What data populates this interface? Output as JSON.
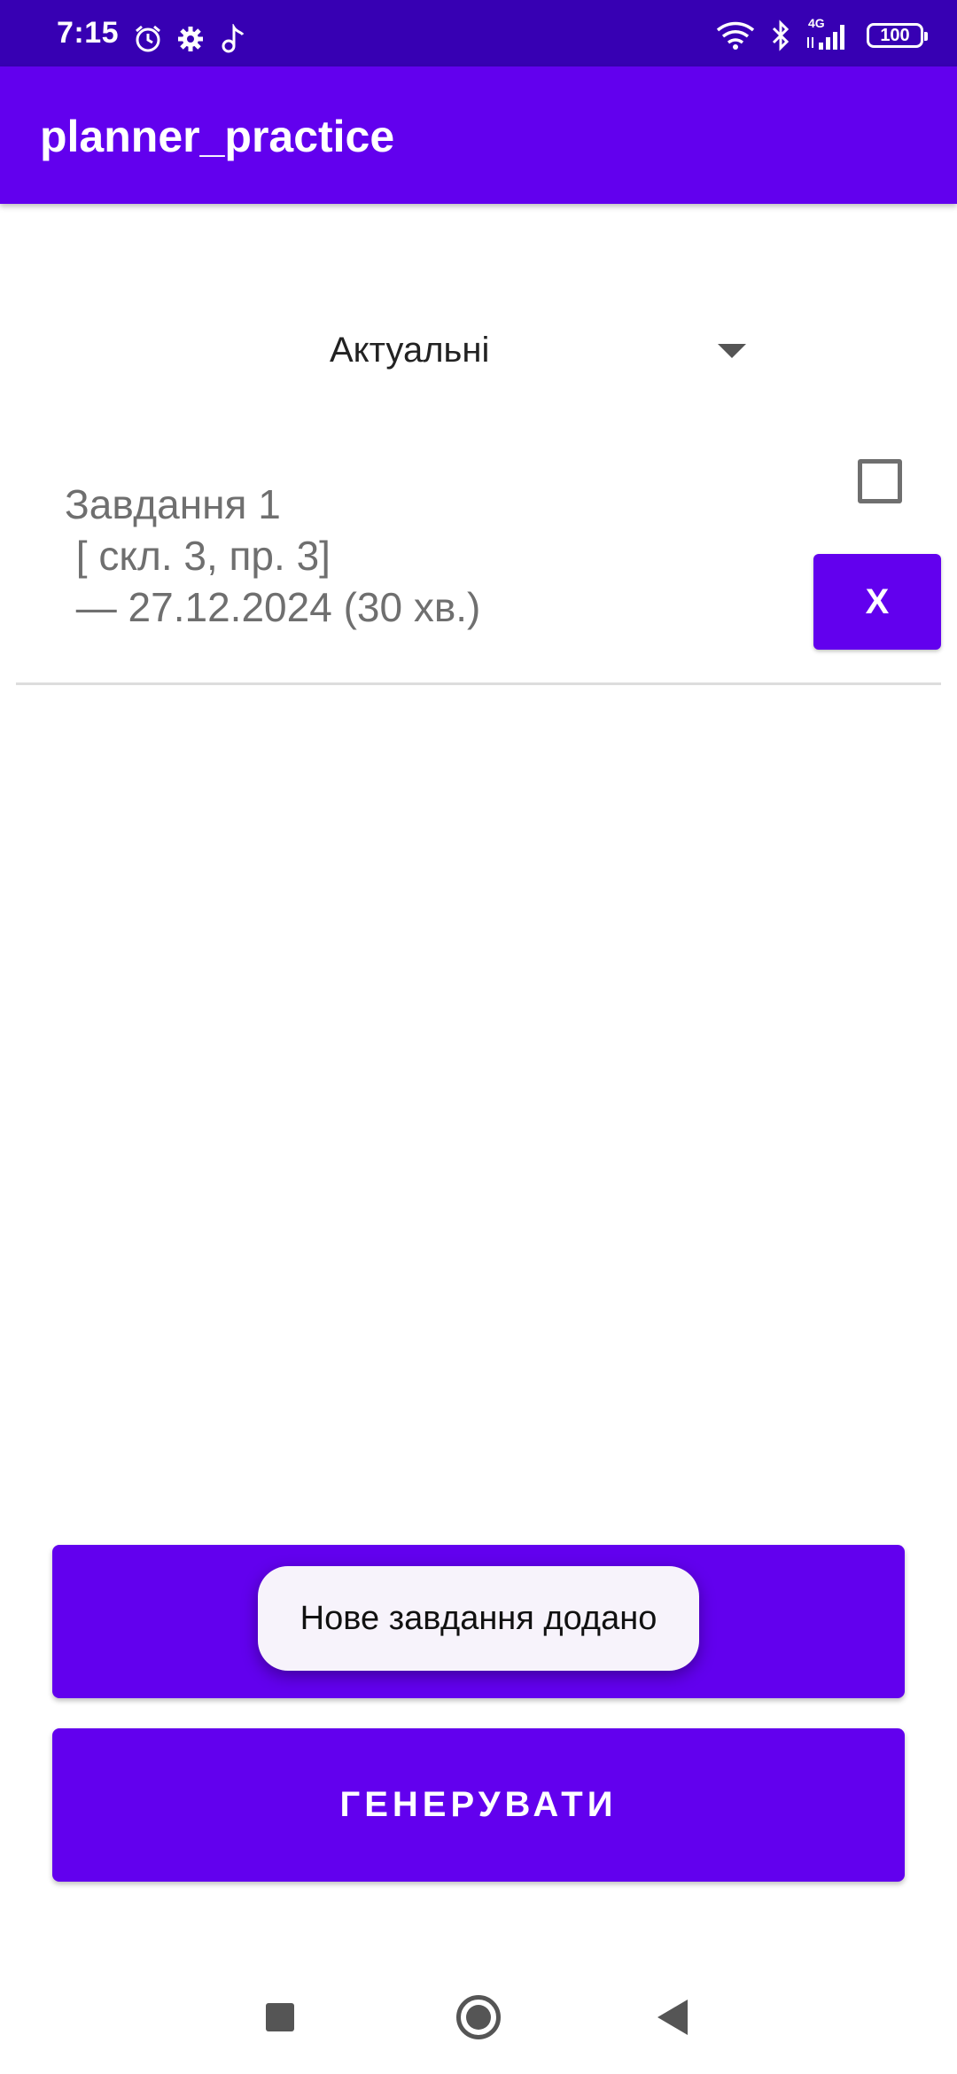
{
  "status_bar": {
    "time": "7:15",
    "icons_left": [
      "alarm-icon",
      "gear-icon",
      "music-note-icon"
    ],
    "icons_right": [
      "wifi-icon",
      "bluetooth-icon",
      "cellular-4g-icon",
      "battery-icon"
    ],
    "network_label": "4G",
    "battery_level": "100"
  },
  "app_bar": {
    "title": "planner_practice",
    "color": "#6200ee"
  },
  "filter_spinner": {
    "selected": "Актуальні"
  },
  "tasks": [
    {
      "title": "Завдання 1",
      "detail": " [ скл. 3, пр. 3]",
      "date_line": " — 27.12.2024 (30 хв.)",
      "checked": false,
      "delete_label": "X"
    }
  ],
  "buttons": {
    "add_label": "",
    "generate_label": "ГЕНЕРУВАТИ"
  },
  "toast": {
    "message": "Нове завдання додано"
  },
  "colors": {
    "status_bar": "#3700b3",
    "primary": "#6200ee",
    "task_text": "#6f6f6f"
  }
}
